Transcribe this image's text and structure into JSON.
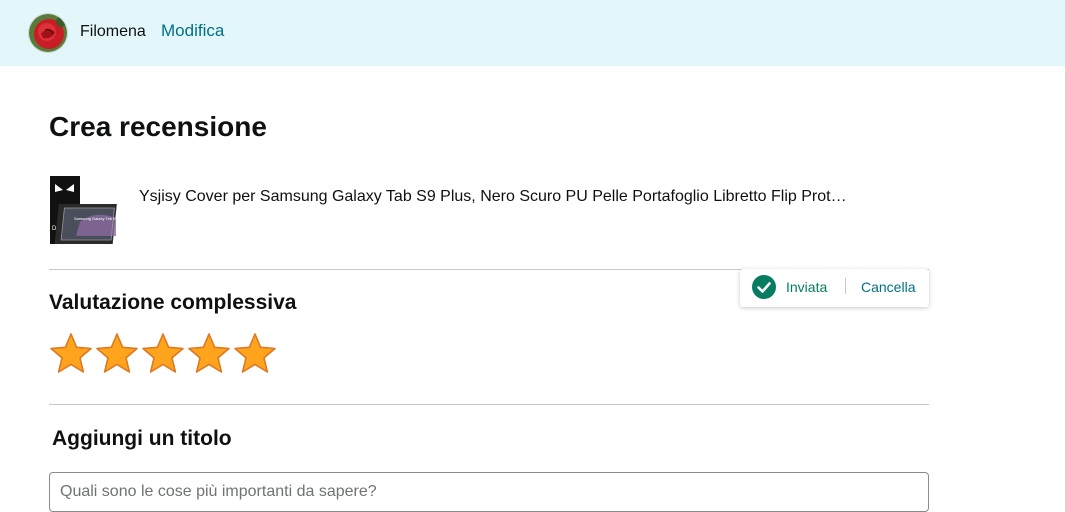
{
  "header": {
    "username": "Filomena",
    "edit_label": "Modifica"
  },
  "page": {
    "title": "Crea recensione"
  },
  "product": {
    "name": "Ysjisy Cover per Samsung Galaxy Tab S9 Plus, Nero Scuro PU Pelle Portafoglio Libretto Flip Prot…"
  },
  "status": {
    "sent_label": "Inviata",
    "cancel_label": "Cancella",
    "accent": "#067d62"
  },
  "rating": {
    "title": "Valutazione complessiva",
    "value": 5,
    "max": 5,
    "star_color": "#ffa41c"
  },
  "headline": {
    "title": "Aggiungi un titolo",
    "placeholder": "Quali sono le cose più importanti da sapere?"
  }
}
